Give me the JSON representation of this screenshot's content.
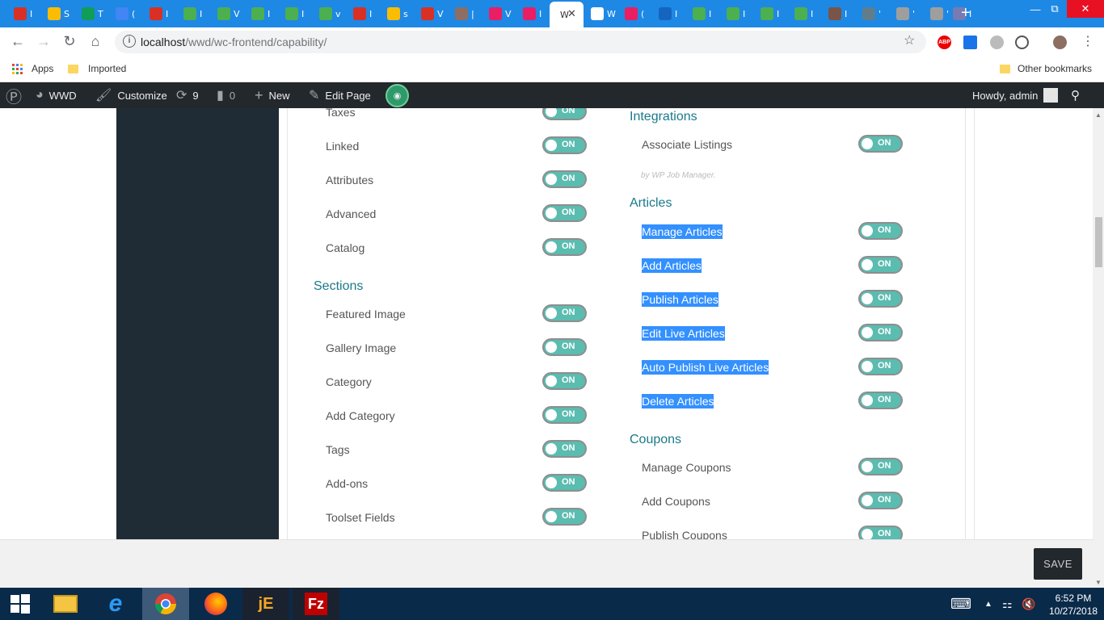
{
  "browser": {
    "tabs": [
      {
        "icon": "gmail-icon",
        "title": "I",
        "color": "#d93025"
      },
      {
        "icon": "drive-icon",
        "title": "S",
        "color": "#fbbc04"
      },
      {
        "icon": "sheets-icon",
        "title": "T",
        "color": "#0f9d58"
      },
      {
        "icon": "site-icon",
        "title": "(",
        "color": "#4285f4"
      },
      {
        "icon": "gmail-icon",
        "title": "I",
        "color": "#d93025"
      },
      {
        "icon": "site-icon",
        "title": "I",
        "color": "#4caf50"
      },
      {
        "icon": "site-icon",
        "title": "V",
        "color": "#4caf50"
      },
      {
        "icon": "site-icon",
        "title": "I",
        "color": "#4caf50"
      },
      {
        "icon": "site-icon",
        "title": "I",
        "color": "#4caf50"
      },
      {
        "icon": "site-icon",
        "title": "v",
        "color": "#4caf50"
      },
      {
        "icon": "gmail-icon",
        "title": "I",
        "color": "#d93025"
      },
      {
        "icon": "site-icon",
        "title": "s",
        "color": "#fbbc04"
      },
      {
        "icon": "gmail-icon",
        "title": "V",
        "color": "#d93025"
      },
      {
        "icon": "site-icon",
        "title": "|",
        "color": "#8d6e63"
      },
      {
        "icon": "site-icon",
        "title": "V",
        "color": "#e91e63"
      },
      {
        "icon": "site-icon",
        "title": "I",
        "color": "#e91e63"
      },
      {
        "icon": "site-icon",
        "title": "W",
        "color": "#ffffff"
      },
      {
        "icon": "site-icon",
        "title": "(",
        "color": "#e91e63"
      },
      {
        "icon": "site-icon",
        "title": "I",
        "color": "#1565c0"
      },
      {
        "icon": "site-icon",
        "title": "I",
        "color": "#4caf50"
      },
      {
        "icon": "site-icon",
        "title": "I",
        "color": "#4caf50"
      },
      {
        "icon": "site-icon",
        "title": "I",
        "color": "#4caf50"
      },
      {
        "icon": "site-icon",
        "title": "I",
        "color": "#4caf50"
      },
      {
        "icon": "site-icon",
        "title": "I",
        "color": "#795548"
      },
      {
        "icon": "site-icon",
        "title": "'",
        "color": "#607d8b"
      },
      {
        "icon": "wordpress-icon",
        "title": "'",
        "color": "#9e9e9e"
      },
      {
        "icon": "wordpress-icon",
        "title": "'",
        "color": "#9e9e9e"
      },
      {
        "icon": "php-icon",
        "title": "I",
        "color": "#777bb3"
      }
    ],
    "new_tab": "+",
    "url_host": "localhost",
    "url_path": "/wwd/wc-frontend/capability/",
    "bookmarks": {
      "apps": "Apps",
      "imported": "Imported",
      "other": "Other bookmarks"
    },
    "extensions": {
      "abp": "ABP"
    }
  },
  "adminbar": {
    "site": "WWD",
    "customize": "Customize",
    "updates": "9",
    "comments": "0",
    "new": "New",
    "edit_page": "Edit Page",
    "howdy": "Howdy, admin"
  },
  "left_column": {
    "top_rows": [
      {
        "label": "Taxes",
        "state": "ON"
      },
      {
        "label": "Linked",
        "state": "ON"
      },
      {
        "label": "Attributes",
        "state": "ON"
      },
      {
        "label": "Advanced",
        "state": "ON"
      },
      {
        "label": "Catalog",
        "state": "ON"
      }
    ],
    "sections_title": "Sections",
    "sections": [
      {
        "label": "Featured Image",
        "state": "ON"
      },
      {
        "label": "Gallery Image",
        "state": "ON"
      },
      {
        "label": "Category",
        "state": "ON"
      },
      {
        "label": "Add Category",
        "state": "ON"
      },
      {
        "label": "Tags",
        "state": "ON"
      },
      {
        "label": "Add-ons",
        "state": "ON"
      },
      {
        "label": "Toolset Fields",
        "state": "ON"
      }
    ]
  },
  "right_column": {
    "integrations_title": "Integrations",
    "integrations": [
      {
        "label": "Associate Listings",
        "state": "ON"
      }
    ],
    "integrations_credit": "by WP Job Manager.",
    "articles_title": "Articles",
    "articles": [
      {
        "label": "Manage Articles",
        "state": "ON"
      },
      {
        "label": "Add Articles",
        "state": "ON"
      },
      {
        "label": "Publish Articles",
        "state": "ON"
      },
      {
        "label": "Edit Live Articles",
        "state": "ON"
      },
      {
        "label": "Auto Publish Live Articles",
        "state": "ON"
      },
      {
        "label": "Delete Articles",
        "state": "ON"
      }
    ],
    "coupons_title": "Coupons",
    "coupons": [
      {
        "label": "Manage Coupons",
        "state": "ON"
      },
      {
        "label": "Add Coupons",
        "state": "ON"
      },
      {
        "label": "Publish Coupons",
        "state": "ON"
      }
    ]
  },
  "save_label": "SAVE",
  "taskbar": {
    "time": "6:52 PM",
    "date": "10/27/2018"
  }
}
